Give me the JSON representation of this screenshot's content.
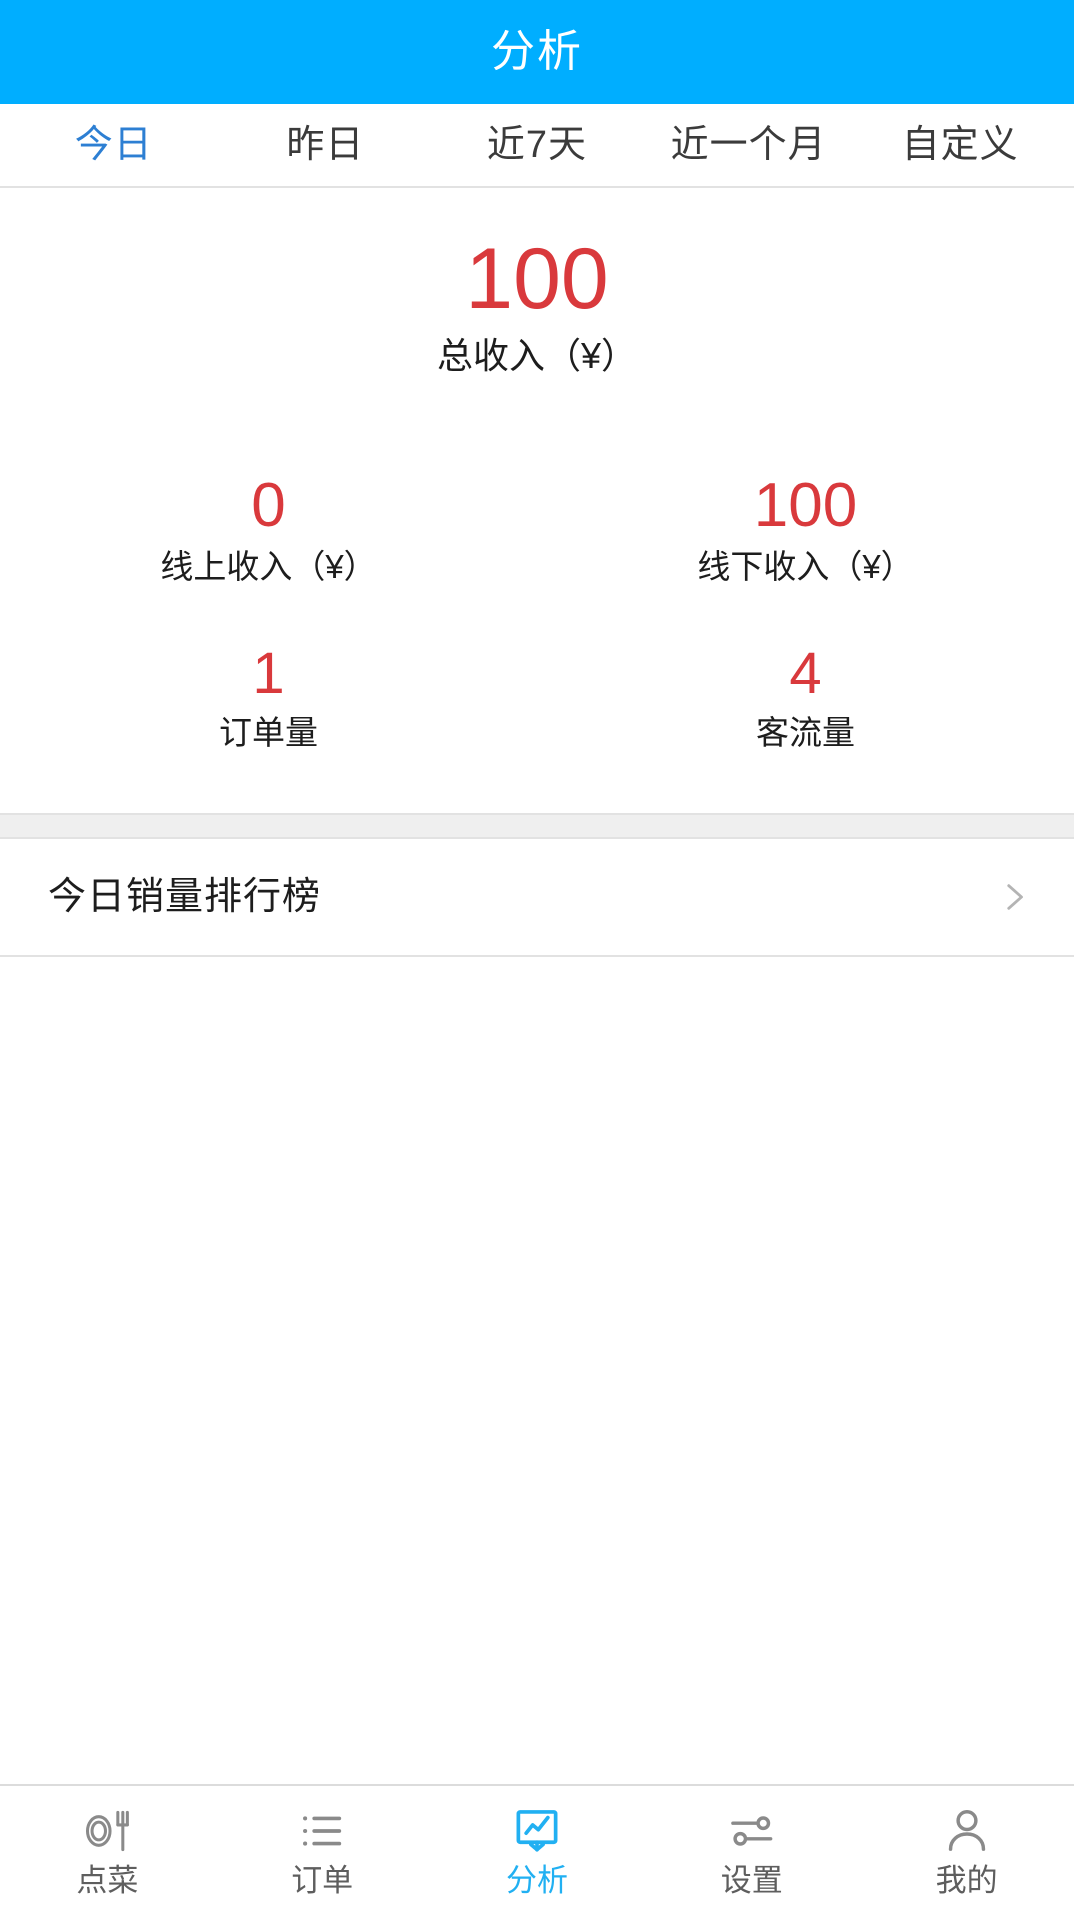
{
  "header": {
    "title": "分析"
  },
  "period_tabs": {
    "active_index": 0,
    "items": [
      {
        "label": "今日"
      },
      {
        "label": "昨日"
      },
      {
        "label": "近7天"
      },
      {
        "label": "近一个月"
      },
      {
        "label": "自定义"
      }
    ]
  },
  "stats": {
    "total": {
      "value": "100",
      "label": "总收入（¥）"
    },
    "revenue_row": [
      {
        "value": "0",
        "label": "线上收入（¥）"
      },
      {
        "value": "100",
        "label": "线下收入（¥）"
      }
    ],
    "count_row": [
      {
        "value": "1",
        "label": "订单量"
      },
      {
        "value": "4",
        "label": "客流量"
      }
    ]
  },
  "ranking": {
    "label": "今日销量排行榜",
    "chevron_icon": "chevron-right-icon"
  },
  "bottom_nav": {
    "active_index": 2,
    "items": [
      {
        "label": "点菜",
        "icon": "plate-fork-icon"
      },
      {
        "label": "订单",
        "icon": "list-icon"
      },
      {
        "label": "分析",
        "icon": "chart-board-icon"
      },
      {
        "label": "设置",
        "icon": "sliders-icon"
      },
      {
        "label": "我的",
        "icon": "person-icon"
      }
    ]
  },
  "colors": {
    "header_blue": "#00aeff",
    "accent_blue": "#21b0f2",
    "tab_active_blue": "#2d7fd3",
    "value_red": "#d9393c",
    "band_gray": "#efefef"
  }
}
